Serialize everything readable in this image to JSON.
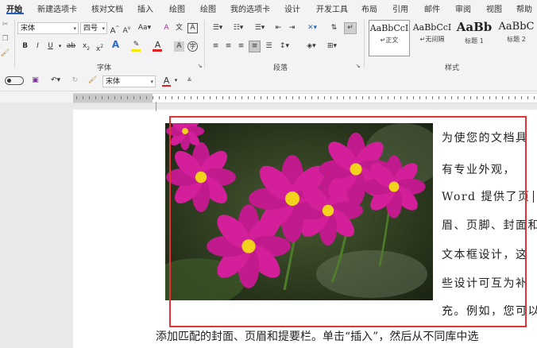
{
  "tabs": [
    {
      "label": "开始",
      "active": true
    },
    {
      "label": "新建选项卡"
    },
    {
      "label": "核对文档"
    },
    {
      "label": "插入"
    },
    {
      "label": "绘图"
    },
    {
      "label": "绘图"
    },
    {
      "label": "我的选项卡"
    },
    {
      "label": "设计"
    },
    {
      "label": "开发工具"
    },
    {
      "label": "布局"
    },
    {
      "label": "引用"
    },
    {
      "label": "邮件"
    },
    {
      "label": "审阅"
    },
    {
      "label": "视图"
    },
    {
      "label": "帮助"
    }
  ],
  "font_group": {
    "font_name": "宋体",
    "font_size": "四号",
    "label": "字体"
  },
  "paragraph_group": {
    "label": "段落"
  },
  "styles_group": {
    "label": "样式",
    "items": [
      {
        "sample": "AaBbCcI",
        "name": "↵正文"
      },
      {
        "sample": "AaBbCcI",
        "name": "↵无间隔"
      },
      {
        "sample": "AaBb",
        "name": "标题 1"
      },
      {
        "sample": "AaBbC",
        "name": "标题 2"
      }
    ]
  },
  "qat": {
    "font_name": "宋体"
  },
  "document": {
    "side_lines": [
      "为使您的文档具",
      "有专业外观，",
      "Word 提供了页",
      "眉、页脚、封面和",
      "文本框设计，这",
      "些设计可互为补",
      "充。例如，您可以"
    ],
    "bottom_line": "添加匹配的封面、页眉和提要栏。单击“插入”，然后从不同库中选"
  },
  "colors": {
    "accent": "#1f5fbf",
    "selection": "#e03535",
    "flower": "#d41f9a"
  }
}
